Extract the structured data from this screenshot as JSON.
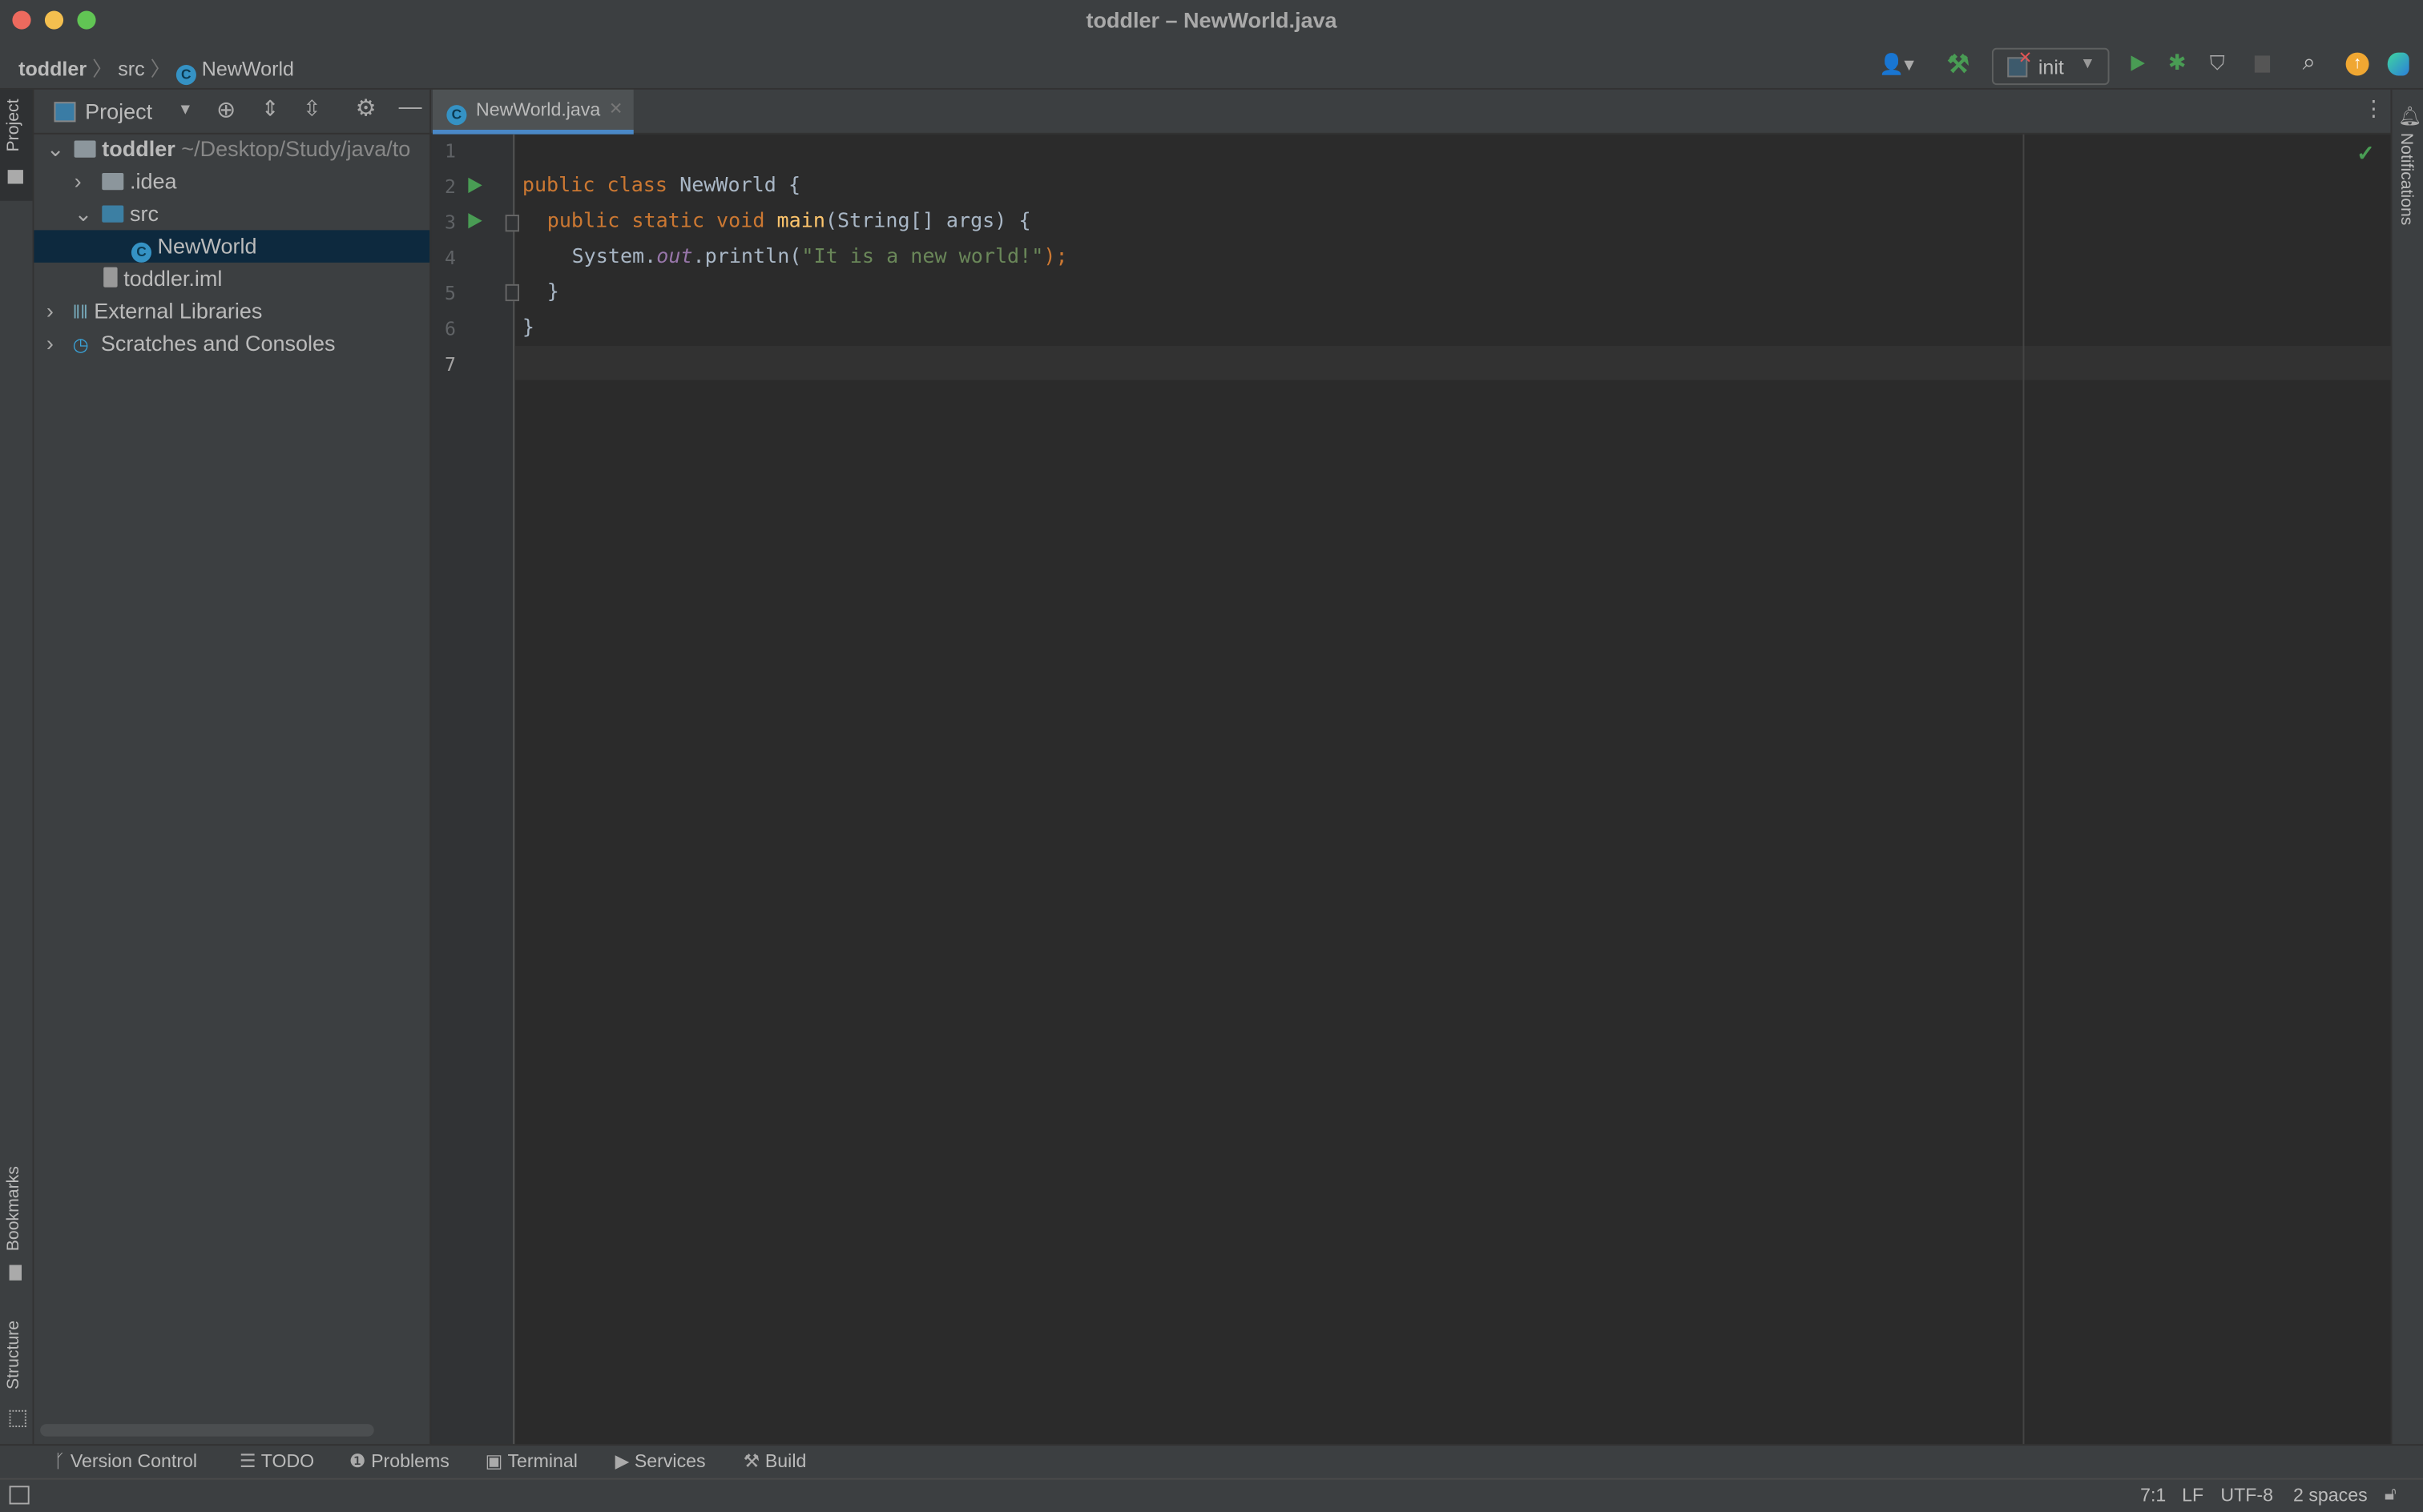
{
  "window": {
    "title": "toddler – NewWorld.java"
  },
  "breadcrumb": [
    {
      "label": "toddler"
    },
    {
      "label": "src"
    },
    {
      "label": "NewWorld"
    }
  ],
  "toolbar": {
    "run_config": "init"
  },
  "left_stripe": {
    "project": "Project",
    "bookmarks": "Bookmarks",
    "structure": "Structure"
  },
  "right_stripe": {
    "notifications": "Notifications"
  },
  "project_panel": {
    "title": "Project",
    "tree": [
      {
        "label": "toddler",
        "path": "~/Desktop/Study/java/to",
        "expanded": true
      },
      {
        "label": ".idea",
        "expanded": false
      },
      {
        "label": "src",
        "expanded": true
      },
      {
        "label": "NewWorld",
        "selected": true
      },
      {
        "label": "toddler.iml"
      },
      {
        "label": "External Libraries",
        "expanded": false
      },
      {
        "label": "Scratches and Consoles",
        "expanded": false
      }
    ]
  },
  "editor": {
    "tab": "NewWorld.java",
    "line_numbers": [
      "1",
      "2",
      "3",
      "4",
      "5",
      "6",
      "7"
    ],
    "lines": {
      "l2": {
        "kw": "public class ",
        "name": "NewWorld {"
      },
      "l3": {
        "kw": "public static void ",
        "fn": "main",
        "rest": "(String[] args) {"
      },
      "l4": {
        "a": "System.",
        "b": "out",
        "c": ".println(",
        "d": "\"It is a new world!\"",
        "e": ");"
      },
      "l5": "}",
      "l6": "}"
    }
  },
  "bottom_tools": [
    "Version Control",
    "TODO",
    "Problems",
    "Terminal",
    "Services",
    "Build"
  ],
  "status": {
    "position": "7:1",
    "line_sep": "LF",
    "encoding": "UTF-8",
    "indent": "2 spaces"
  },
  "colors": {
    "accent": "#4a88c7",
    "run": "#499c54",
    "keyword": "#cc7832",
    "string": "#6a8759",
    "selection": "#0d293e"
  }
}
